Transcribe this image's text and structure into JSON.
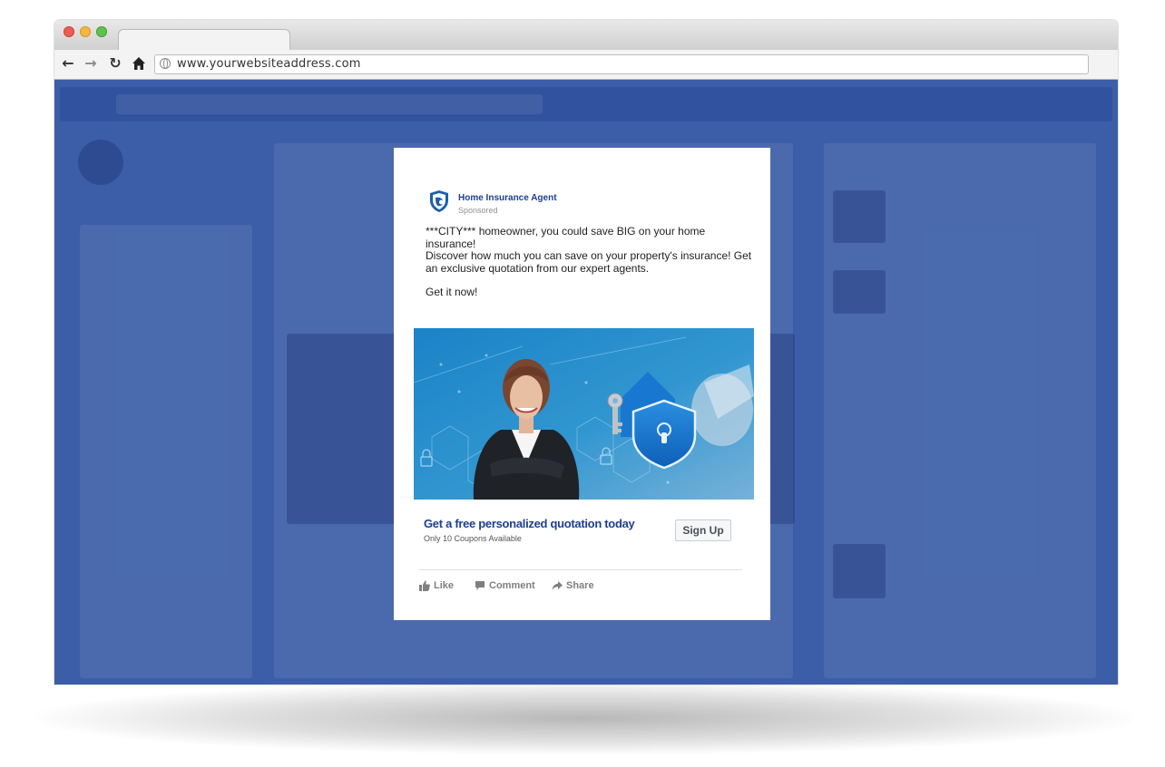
{
  "browser": {
    "url": "www.yourwebsiteaddress.com"
  },
  "ad": {
    "brand_name": "Home Insurance Agent",
    "sponsored_label": "Sponsored",
    "body": {
      "line1": "***CITY*** homeowner, you could save BIG on your home insurance!",
      "line2": "Discover how much you can save on your property's insurance! Get an exclusive quotation from our expert agents.",
      "line3": "Get it now!"
    },
    "cta": {
      "headline": "Get a free personalized quotation today",
      "subtext": "Only 10 Coupons Available",
      "button_label": "Sign Up"
    },
    "actions": {
      "like": "Like",
      "comment": "Comment",
      "share": "Share"
    }
  },
  "colors": {
    "page_overlay": "#3c5ea8",
    "brand_blue": "#1d3f8f",
    "image_blue": "#1e8fd0"
  },
  "icons": [
    "globe-icon",
    "back-arrow-icon",
    "forward-arrow-icon",
    "reload-icon",
    "home-icon",
    "shield-logo-icon",
    "thumbs-up-icon",
    "comment-icon",
    "share-icon",
    "padlock-shield-icon",
    "key-icon"
  ]
}
